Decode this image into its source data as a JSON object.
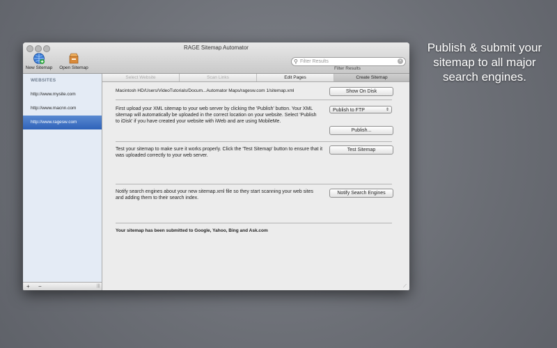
{
  "promo": {
    "text": "Publish & submit your sitemap to all major search engines."
  },
  "window": {
    "title": "RAGE Sitemap Automator",
    "toolbar": {
      "new_sitemap": "New Sitemap",
      "open_sitemap": "Open Sitemap"
    },
    "search": {
      "placeholder": "Filter Results",
      "label": "Filter Results"
    }
  },
  "sidebar": {
    "heading": "WEBSITES",
    "items": [
      {
        "label": "http://www.mysite.com"
      },
      {
        "label": "http://www.macnn.com"
      },
      {
        "label": "http://www.ragesw.com"
      }
    ],
    "add_label": "+",
    "remove_label": "−",
    "grip": "|||"
  },
  "tabs": [
    {
      "label": "Select Website"
    },
    {
      "label": "Scan Links"
    },
    {
      "label": "Edit Pages"
    },
    {
      "label": "Create Sitemap"
    }
  ],
  "content": {
    "path": "Macintosh HD/Users/VideoTutorials/Docum...Automator Maps/ragesw.com 1/sitemap.xml",
    "show_on_disk": "Show On Disk",
    "upload_text": "First upload your XML sitemap to your web server by clicking the 'Publish' button. Your XML sitemap will automatically be uploaded in the correct location on your website. Select 'Publish to iDisk' if you have created your website with iWeb and are using MobileMe.",
    "publish_option": "Publish to FTP",
    "publish_button": "Publish...",
    "test_text": "Test your sitemap to make sure it works properly. Click the 'Test Sitemap' button to ensure that it was uploaded correctly to your web server.",
    "test_button": "Test Sitemap",
    "notify_text": "Notify search engines about your new sitemap.xml file so they start scanning your web sites and adding them to their search index.",
    "notify_button": "Notify Search Engines",
    "status": "Your sitemap has been submitted to Google, Yahoo, Bing and Ask.com"
  },
  "colors": {
    "selection": "#3a6cc2",
    "sidebar_bg": "#e4ebf5",
    "window_bg": "#ececec"
  }
}
